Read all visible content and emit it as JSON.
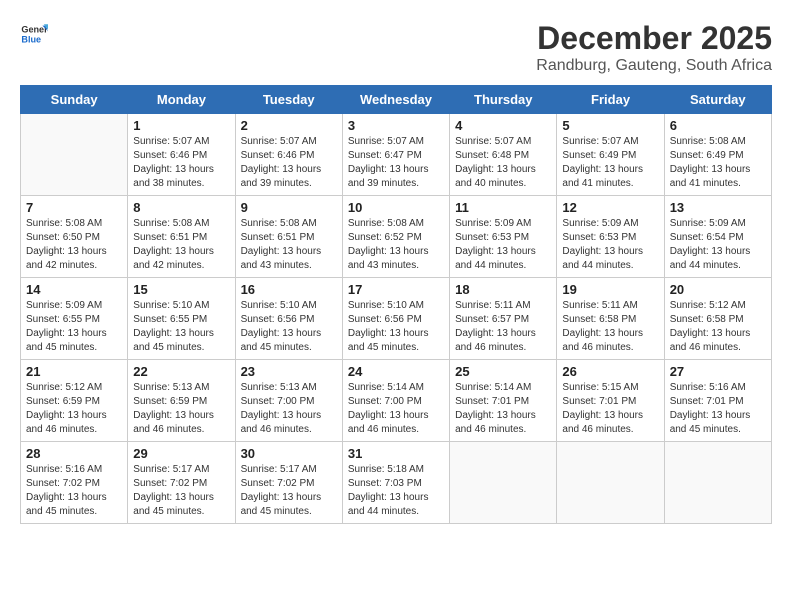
{
  "logo": {
    "line1": "General",
    "line2": "Blue"
  },
  "title": "December 2025",
  "subtitle": "Randburg, Gauteng, South Africa",
  "weekdays": [
    "Sunday",
    "Monday",
    "Tuesday",
    "Wednesday",
    "Thursday",
    "Friday",
    "Saturday"
  ],
  "weeks": [
    [
      {
        "day": "",
        "info": ""
      },
      {
        "day": "1",
        "info": "Sunrise: 5:07 AM\nSunset: 6:46 PM\nDaylight: 13 hours\nand 38 minutes."
      },
      {
        "day": "2",
        "info": "Sunrise: 5:07 AM\nSunset: 6:46 PM\nDaylight: 13 hours\nand 39 minutes."
      },
      {
        "day": "3",
        "info": "Sunrise: 5:07 AM\nSunset: 6:47 PM\nDaylight: 13 hours\nand 39 minutes."
      },
      {
        "day": "4",
        "info": "Sunrise: 5:07 AM\nSunset: 6:48 PM\nDaylight: 13 hours\nand 40 minutes."
      },
      {
        "day": "5",
        "info": "Sunrise: 5:07 AM\nSunset: 6:49 PM\nDaylight: 13 hours\nand 41 minutes."
      },
      {
        "day": "6",
        "info": "Sunrise: 5:08 AM\nSunset: 6:49 PM\nDaylight: 13 hours\nand 41 minutes."
      }
    ],
    [
      {
        "day": "7",
        "info": "Sunrise: 5:08 AM\nSunset: 6:50 PM\nDaylight: 13 hours\nand 42 minutes."
      },
      {
        "day": "8",
        "info": "Sunrise: 5:08 AM\nSunset: 6:51 PM\nDaylight: 13 hours\nand 42 minutes."
      },
      {
        "day": "9",
        "info": "Sunrise: 5:08 AM\nSunset: 6:51 PM\nDaylight: 13 hours\nand 43 minutes."
      },
      {
        "day": "10",
        "info": "Sunrise: 5:08 AM\nSunset: 6:52 PM\nDaylight: 13 hours\nand 43 minutes."
      },
      {
        "day": "11",
        "info": "Sunrise: 5:09 AM\nSunset: 6:53 PM\nDaylight: 13 hours\nand 44 minutes."
      },
      {
        "day": "12",
        "info": "Sunrise: 5:09 AM\nSunset: 6:53 PM\nDaylight: 13 hours\nand 44 minutes."
      },
      {
        "day": "13",
        "info": "Sunrise: 5:09 AM\nSunset: 6:54 PM\nDaylight: 13 hours\nand 44 minutes."
      }
    ],
    [
      {
        "day": "14",
        "info": "Sunrise: 5:09 AM\nSunset: 6:55 PM\nDaylight: 13 hours\nand 45 minutes."
      },
      {
        "day": "15",
        "info": "Sunrise: 5:10 AM\nSunset: 6:55 PM\nDaylight: 13 hours\nand 45 minutes."
      },
      {
        "day": "16",
        "info": "Sunrise: 5:10 AM\nSunset: 6:56 PM\nDaylight: 13 hours\nand 45 minutes."
      },
      {
        "day": "17",
        "info": "Sunrise: 5:10 AM\nSunset: 6:56 PM\nDaylight: 13 hours\nand 45 minutes."
      },
      {
        "day": "18",
        "info": "Sunrise: 5:11 AM\nSunset: 6:57 PM\nDaylight: 13 hours\nand 46 minutes."
      },
      {
        "day": "19",
        "info": "Sunrise: 5:11 AM\nSunset: 6:58 PM\nDaylight: 13 hours\nand 46 minutes."
      },
      {
        "day": "20",
        "info": "Sunrise: 5:12 AM\nSunset: 6:58 PM\nDaylight: 13 hours\nand 46 minutes."
      }
    ],
    [
      {
        "day": "21",
        "info": "Sunrise: 5:12 AM\nSunset: 6:59 PM\nDaylight: 13 hours\nand 46 minutes."
      },
      {
        "day": "22",
        "info": "Sunrise: 5:13 AM\nSunset: 6:59 PM\nDaylight: 13 hours\nand 46 minutes."
      },
      {
        "day": "23",
        "info": "Sunrise: 5:13 AM\nSunset: 7:00 PM\nDaylight: 13 hours\nand 46 minutes."
      },
      {
        "day": "24",
        "info": "Sunrise: 5:14 AM\nSunset: 7:00 PM\nDaylight: 13 hours\nand 46 minutes."
      },
      {
        "day": "25",
        "info": "Sunrise: 5:14 AM\nSunset: 7:01 PM\nDaylight: 13 hours\nand 46 minutes."
      },
      {
        "day": "26",
        "info": "Sunrise: 5:15 AM\nSunset: 7:01 PM\nDaylight: 13 hours\nand 46 minutes."
      },
      {
        "day": "27",
        "info": "Sunrise: 5:16 AM\nSunset: 7:01 PM\nDaylight: 13 hours\nand 45 minutes."
      }
    ],
    [
      {
        "day": "28",
        "info": "Sunrise: 5:16 AM\nSunset: 7:02 PM\nDaylight: 13 hours\nand 45 minutes."
      },
      {
        "day": "29",
        "info": "Sunrise: 5:17 AM\nSunset: 7:02 PM\nDaylight: 13 hours\nand 45 minutes."
      },
      {
        "day": "30",
        "info": "Sunrise: 5:17 AM\nSunset: 7:02 PM\nDaylight: 13 hours\nand 45 minutes."
      },
      {
        "day": "31",
        "info": "Sunrise: 5:18 AM\nSunset: 7:03 PM\nDaylight: 13 hours\nand 44 minutes."
      },
      {
        "day": "",
        "info": ""
      },
      {
        "day": "",
        "info": ""
      },
      {
        "day": "",
        "info": ""
      }
    ]
  ]
}
